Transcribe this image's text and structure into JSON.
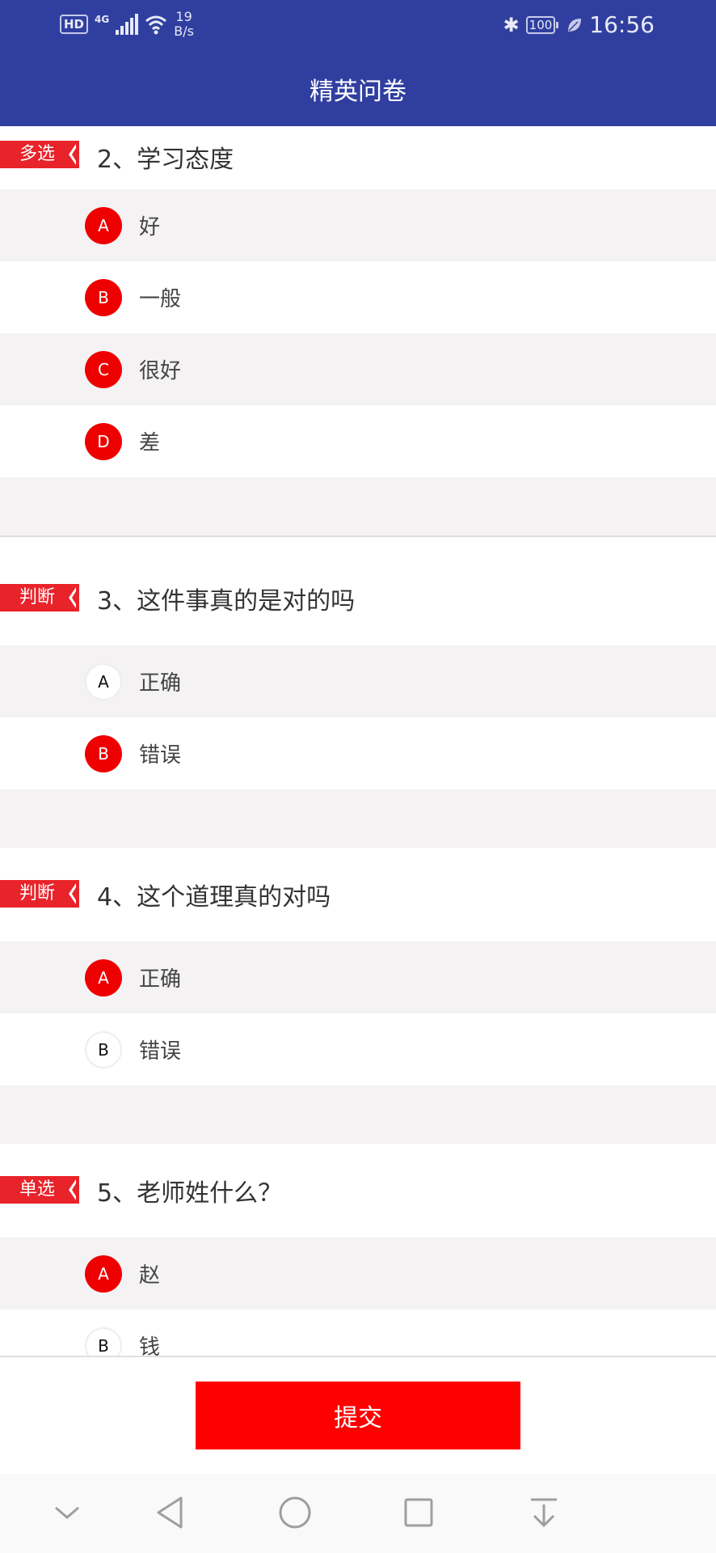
{
  "status_bar": {
    "hd": "HD",
    "network": "4G",
    "rate_value": "19",
    "rate_unit": "B/s",
    "bluetooth": "✱",
    "battery": "100",
    "time": "16:56"
  },
  "app_bar": {
    "title": "精英问卷"
  },
  "questions": [
    {
      "tag": "多选",
      "title": "2、学习态度",
      "options": [
        {
          "letter": "A",
          "text": "好",
          "selected": true
        },
        {
          "letter": "B",
          "text": "一般",
          "selected": true
        },
        {
          "letter": "C",
          "text": "很好",
          "selected": true
        },
        {
          "letter": "D",
          "text": "差",
          "selected": true
        }
      ]
    },
    {
      "tag": "判断",
      "title": "3、这件事真的是对的吗",
      "options": [
        {
          "letter": "A",
          "text": "正确",
          "selected": false
        },
        {
          "letter": "B",
          "text": "错误",
          "selected": true
        }
      ]
    },
    {
      "tag": "判断",
      "title": "4、这个道理真的对吗",
      "options": [
        {
          "letter": "A",
          "text": "正确",
          "selected": true
        },
        {
          "letter": "B",
          "text": "错误",
          "selected": false
        }
      ]
    },
    {
      "tag": "单选",
      "title": "5、老师姓什么？",
      "options": [
        {
          "letter": "A",
          "text": "赵",
          "selected": true
        },
        {
          "letter": "B",
          "text": "钱",
          "selected": false
        }
      ]
    }
  ],
  "footer": {
    "submit_label": "提交"
  },
  "colors": {
    "app_bar": "#303f9f",
    "accent": "#ee0000",
    "tag": "#e8232a"
  }
}
